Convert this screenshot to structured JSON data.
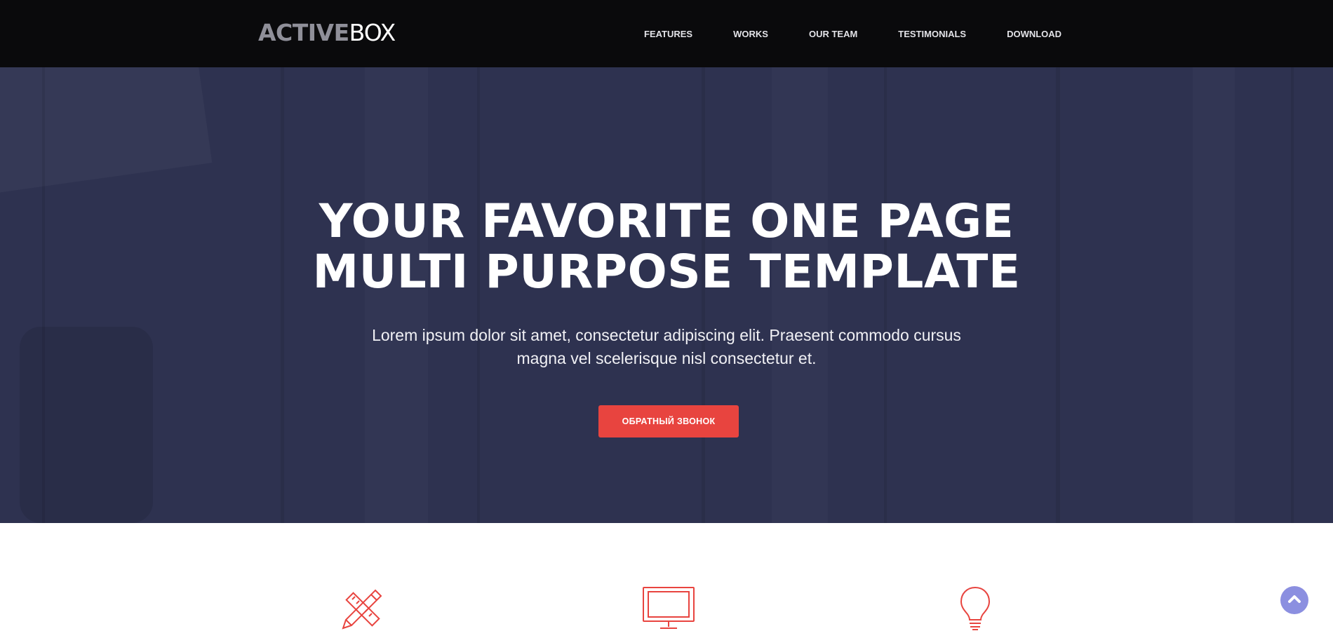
{
  "header": {
    "logo_bold": "ACTIVE",
    "logo_thin": "BOX",
    "nav": [
      {
        "label": "FEATURES"
      },
      {
        "label": "WORKS"
      },
      {
        "label": "OUR TEAM"
      },
      {
        "label": "TESTIMONIALS"
      },
      {
        "label": "DOWNLOAD"
      }
    ]
  },
  "hero": {
    "title_line1": "YOUR FAVORITE ONE PAGE",
    "title_line2": "MULTI PURPOSE TEMPLATE",
    "subtitle_line1": "Lorem ipsum dolor sit amet, consectetur adipiscing elit. Praesent commodo cursus",
    "subtitle_line2": "magna vel scelerisque nisl consectetur et.",
    "cta_label": "ОБРАТНЫЙ ЗВОНОК"
  },
  "features": {
    "icons": [
      "pencil-ruler-icon",
      "monitor-icon",
      "lightbulb-icon"
    ]
  },
  "colors": {
    "accent": "#e8443f",
    "header_bg": "#0a0a0c",
    "hero_bg": "#2e3250",
    "scroll_button": "#8b8fe0"
  }
}
